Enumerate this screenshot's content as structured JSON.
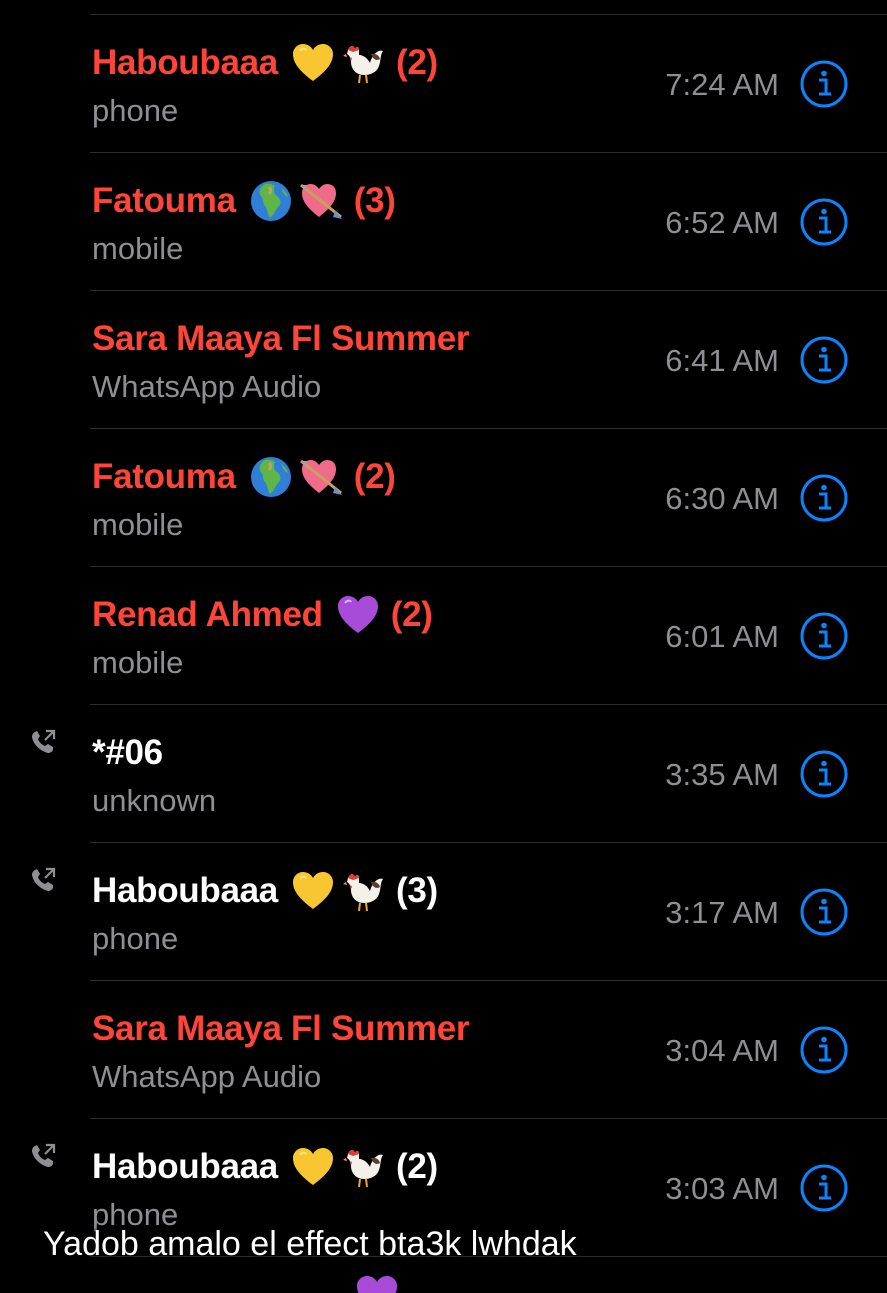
{
  "calls": [
    {
      "name": "Haboubaaa",
      "emojis": [
        "yellow-heart",
        "rooster"
      ],
      "count": "(2)",
      "type": "phone",
      "time": "7:24 AM",
      "missed": true,
      "outgoing": false
    },
    {
      "name": "Fatouma",
      "emojis": [
        "globe",
        "heart-arrow"
      ],
      "count": "(3)",
      "type": "mobile",
      "time": "6:52 AM",
      "missed": true,
      "outgoing": false
    },
    {
      "name": "Sara Maaya Fl Summer",
      "emojis": [],
      "count": "",
      "type": "WhatsApp Audio",
      "time": "6:41 AM",
      "missed": true,
      "outgoing": false
    },
    {
      "name": "Fatouma",
      "emojis": [
        "globe",
        "heart-arrow"
      ],
      "count": "(2)",
      "type": "mobile",
      "time": "6:30 AM",
      "missed": true,
      "outgoing": false
    },
    {
      "name": "Renad Ahmed",
      "emojis": [
        "purple-heart"
      ],
      "count": "(2)",
      "type": "mobile",
      "time": "6:01 AM",
      "missed": true,
      "outgoing": false
    },
    {
      "name": "*#06",
      "emojis": [],
      "count": "",
      "type": "unknown",
      "time": "3:35 AM",
      "missed": false,
      "outgoing": true
    },
    {
      "name": "Haboubaaa",
      "emojis": [
        "yellow-heart",
        "rooster"
      ],
      "count": "(3)",
      "type": "phone",
      "time": "3:17 AM",
      "missed": false,
      "outgoing": true
    },
    {
      "name": "Sara Maaya Fl Summer",
      "emojis": [],
      "count": "",
      "type": "WhatsApp Audio",
      "time": "3:04 AM",
      "missed": true,
      "outgoing": false
    },
    {
      "name": "Haboubaaa",
      "emojis": [
        "yellow-heart",
        "rooster"
      ],
      "count": "(2)",
      "type": "phone",
      "time": "3:03 AM",
      "missed": false,
      "outgoing": true
    }
  ],
  "caption": "Yadob amalo el effect bta3k lwhdak",
  "colors": {
    "missed": "#fe453a",
    "normal": "#ffffff",
    "secondary": "#8e8e93",
    "accent": "#0a84ff",
    "background": "#000000",
    "divider": "#2c2c2e"
  },
  "icons": {
    "info": "info-circle-icon",
    "outgoing": "outgoing-call-icon"
  }
}
